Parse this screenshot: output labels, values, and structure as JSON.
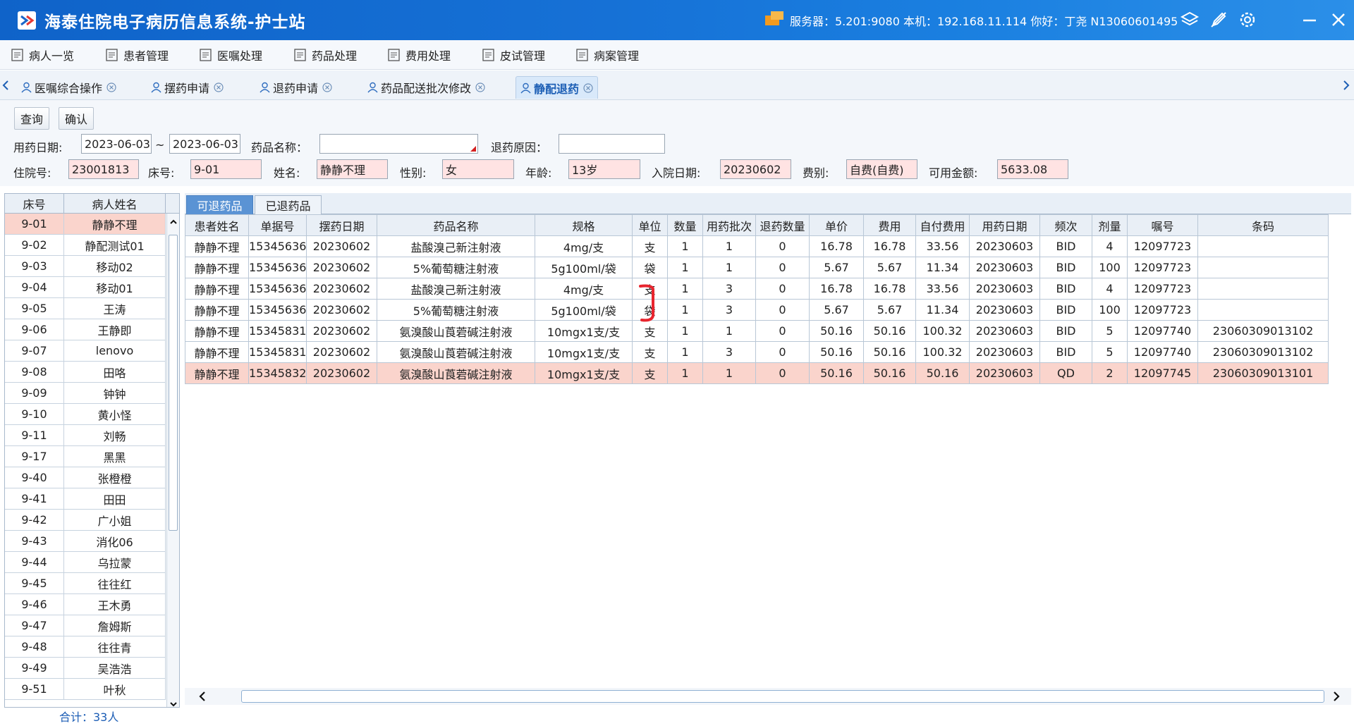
{
  "title_bar": {
    "app_title": "海泰住院电子病历信息系统-护士站",
    "server_info": "服务器：5.201:9080  本机：192.168.11.114  你好：丁尧 N13060601495"
  },
  "menu": [
    {
      "label": "病人一览"
    },
    {
      "label": "患者管理"
    },
    {
      "label": "医嘱处理"
    },
    {
      "label": "药品处理"
    },
    {
      "label": "费用处理"
    },
    {
      "label": "皮试管理"
    },
    {
      "label": "病案管理"
    }
  ],
  "tabs": [
    {
      "label": "医嘱综合操作"
    },
    {
      "label": "摆药申请"
    },
    {
      "label": "退药申请"
    },
    {
      "label": "药品配送批次修改"
    },
    {
      "label": "静配退药"
    }
  ],
  "toolbar": {
    "query_label": "查询",
    "confirm_label": "确认"
  },
  "form": {
    "med_date_label": "用药日期:",
    "date_from": "2023-06-03",
    "date_sep": "~",
    "date_to": "2023-06-03",
    "drug_name_label": "药品名称：",
    "drug_name_value": "",
    "reason_label": "退药原因：",
    "reason_value": "",
    "inpatient_no_label": "住院号:",
    "inpatient_no": "23001813",
    "bed_label": "床号:",
    "bed": "9-01",
    "name_label": "姓名:",
    "name": "静静不理",
    "gender_label": "性别:",
    "gender": "女",
    "age_label": "年龄:",
    "age": "13岁",
    "admit_date_label": "入院日期:",
    "admit_date": "20230602",
    "fee_type_label": "费别:",
    "fee_type": "自费(自费)",
    "balance_label": "可用金额:",
    "balance": "5633.08"
  },
  "patient_list": {
    "headers": {
      "bed": "床号",
      "name": "病人姓名"
    },
    "rows": [
      {
        "bed": "9-01",
        "name": "静静不理"
      },
      {
        "bed": "9-02",
        "name": "静配测试01"
      },
      {
        "bed": "9-03",
        "name": "移动02"
      },
      {
        "bed": "9-04",
        "name": "移动01"
      },
      {
        "bed": "9-05",
        "name": "王涛"
      },
      {
        "bed": "9-06",
        "name": "王静即"
      },
      {
        "bed": "9-07",
        "name": "lenovo"
      },
      {
        "bed": "9-08",
        "name": "田咯"
      },
      {
        "bed": "9-09",
        "name": "钟钟"
      },
      {
        "bed": "9-10",
        "name": "黄小怪"
      },
      {
        "bed": "9-11",
        "name": "刘畅"
      },
      {
        "bed": "9-17",
        "name": "黑黑"
      },
      {
        "bed": "9-40",
        "name": "张橙橙"
      },
      {
        "bed": "9-41",
        "name": "田田"
      },
      {
        "bed": "9-42",
        "name": "广小姐"
      },
      {
        "bed": "9-43",
        "name": "消化06"
      },
      {
        "bed": "9-44",
        "name": "乌拉蒙"
      },
      {
        "bed": "9-45",
        "name": "往往红"
      },
      {
        "bed": "9-46",
        "name": "王木勇"
      },
      {
        "bed": "9-47",
        "name": "詹姆斯"
      },
      {
        "bed": "9-48",
        "name": "往往青"
      },
      {
        "bed": "9-49",
        "name": "吴浩浩"
      },
      {
        "bed": "9-51",
        "name": "叶秋"
      }
    ],
    "total": "合计：33人"
  },
  "sub_tabs": [
    {
      "label": "可退药品"
    },
    {
      "label": "已退药品"
    }
  ],
  "grid": {
    "headers": [
      "患者姓名",
      "单据号",
      "摆药日期",
      "药品名称",
      "规格",
      "单位",
      "数量",
      "用药批次",
      "退药数量",
      "单价",
      "费用",
      "自付费用",
      "用药日期",
      "频次",
      "剂量",
      "嘱号",
      "条码"
    ],
    "rows": [
      [
        "静静不理",
        "15345636",
        "20230602",
        "盐酸溴己新注射液",
        "4mg/支",
        "支",
        "1",
        "1",
        "0",
        "16.78",
        "16.78",
        "33.56",
        "20230603",
        "BID",
        "4",
        "12097723",
        ""
      ],
      [
        "静静不理",
        "15345636",
        "20230602",
        "5%葡萄糖注射液",
        "5g100ml/袋",
        "袋",
        "1",
        "1",
        "0",
        "5.67",
        "5.67",
        "11.34",
        "20230603",
        "BID",
        "100",
        "12097723",
        ""
      ],
      [
        "静静不理",
        "15345636",
        "20230602",
        "盐酸溴己新注射液",
        "4mg/支",
        "支",
        "1",
        "3",
        "0",
        "16.78",
        "16.78",
        "33.56",
        "20230603",
        "BID",
        "4",
        "12097723",
        ""
      ],
      [
        "静静不理",
        "15345636",
        "20230602",
        "5%葡萄糖注射液",
        "5g100ml/袋",
        "袋",
        "1",
        "3",
        "0",
        "5.67",
        "5.67",
        "11.34",
        "20230603",
        "BID",
        "100",
        "12097723",
        ""
      ],
      [
        "静静不理",
        "15345831",
        "20230602",
        "氨溴酸山莨菪碱注射液",
        "10mgx1支/支",
        "支",
        "1",
        "1",
        "0",
        "50.16",
        "50.16",
        "100.32",
        "20230603",
        "BID",
        "5",
        "12097740",
        "23060309013102"
      ],
      [
        "静静不理",
        "15345831",
        "20230602",
        "氨溴酸山莨菪碱注射液",
        "10mgx1支/支",
        "支",
        "1",
        "3",
        "0",
        "50.16",
        "50.16",
        "100.32",
        "20230603",
        "BID",
        "5",
        "12097740",
        "23060309013102"
      ],
      [
        "静静不理",
        "15345832",
        "20230602",
        "氨溴酸山莨菪碱注射液",
        "10mgx1支/支",
        "支",
        "1",
        "1",
        "0",
        "50.16",
        "50.16",
        "50.16",
        "20230603",
        "QD",
        "2",
        "12097745",
        "23060309013101"
      ]
    ]
  },
  "colors": {
    "title_bar": "#1671d6",
    "selected_row": "#fad4cc",
    "pink_field": "#ffe3e3",
    "active_subtab": "#5a93d4",
    "annotation": "#e8252e"
  }
}
